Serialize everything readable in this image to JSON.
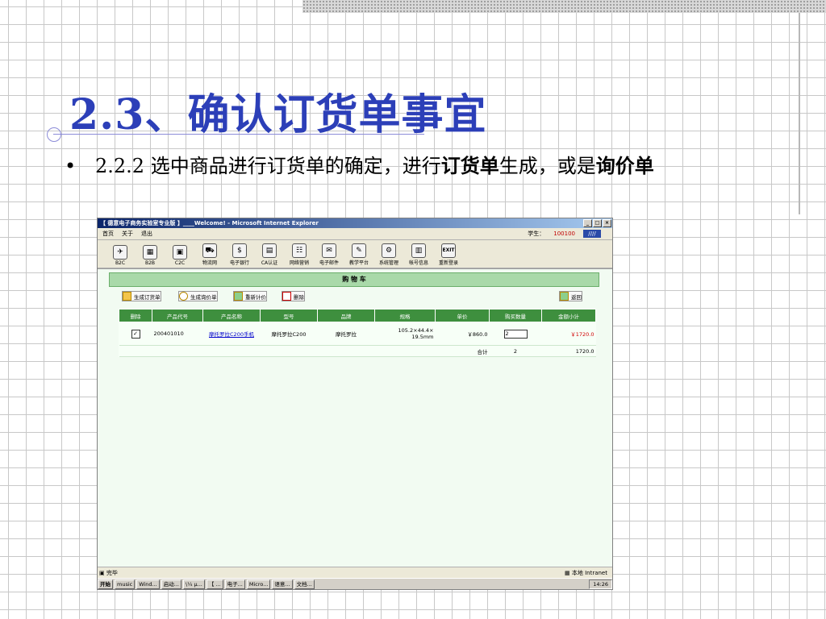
{
  "slide": {
    "title": "2.3、确认订货单事宜",
    "bullet": "•",
    "text_prefix": "2.2.2  选中商品进行订货单的确定，进行",
    "bold1": "订货单",
    "text_mid": "生成，或是",
    "bold2": "询价单"
  },
  "window": {
    "title": "【 德意电子商务实验室专业版 】____Welcome! - Microsoft Internet Explorer",
    "minimize": "_",
    "maximize": "□",
    "close": "×"
  },
  "menu": {
    "home": "首页",
    "about": "关于",
    "logout": "退出",
    "student_label": "学生：",
    "student_id": "100100",
    "logo": "////"
  },
  "toolbar": [
    {
      "label": "B2C",
      "icon": "b2c-icon"
    },
    {
      "label": "B2B",
      "icon": "b2b-icon"
    },
    {
      "label": "C2C",
      "icon": "c2c-icon"
    },
    {
      "label": "物流网",
      "icon": "truck-icon"
    },
    {
      "label": "电子银行",
      "icon": "bank-icon"
    },
    {
      "label": "CA认证",
      "icon": "certificate-icon"
    },
    {
      "label": "网络营销",
      "icon": "network-icon"
    },
    {
      "label": "电子邮件",
      "icon": "mail-icon"
    },
    {
      "label": "教学平台",
      "icon": "teaching-icon"
    },
    {
      "label": "系统管理",
      "icon": "system-icon"
    },
    {
      "label": "帐号信息",
      "icon": "account-icon"
    },
    {
      "label": "重新登录",
      "icon": "exit-icon",
      "top": "EXIT"
    }
  ],
  "cart": {
    "title": "购 物 车",
    "buttons": {
      "gen_order": "生成订货单",
      "gen_inquiry": "生成询价单",
      "recalc": "重新计价",
      "delete": "删除",
      "back": "返回"
    },
    "headers": [
      "删除",
      "产品代号",
      "产品名称",
      "型号",
      "品牌",
      "规格",
      "单价",
      "购买数量",
      "金额小计"
    ],
    "rows": [
      {
        "checked": "✓",
        "code": "200401010",
        "name": "摩托罗拉C200手机",
        "model": "摩托罗拉C200",
        "brand": "摩托罗拉",
        "spec1": "105.2×44.4×",
        "spec2": "19.5mm",
        "price": "￥860.0",
        "qty": "2",
        "subtotal": "￥1720.0"
      }
    ],
    "total": {
      "label": "合计",
      "qty": "2",
      "amount": "1720.0"
    }
  },
  "statusbar": {
    "left": "完毕",
    "zone": "本地 Intranet"
  },
  "taskbar": {
    "start": "开始",
    "tasks": [
      "music",
      "Wind...",
      "启动...",
      "\\¼ µ...",
      "【 ...",
      "电子...",
      "Micro...",
      "语意...",
      "文档..."
    ],
    "clock": "14:26"
  },
  "colors": {
    "title": "#2c3fb8",
    "header": "#3e8f3e",
    "price_red": "#d00000"
  }
}
